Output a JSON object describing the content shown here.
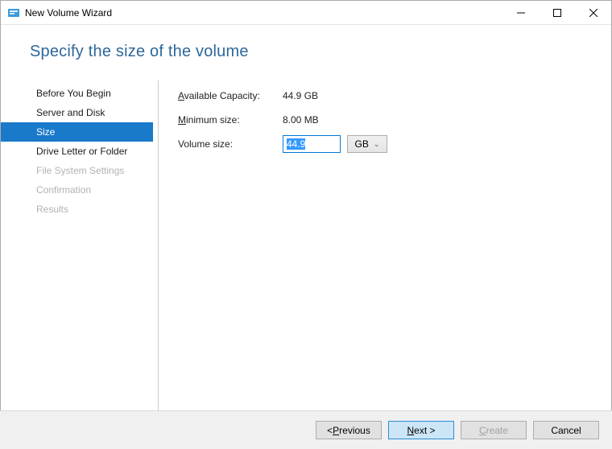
{
  "window": {
    "title": "New Volume Wizard"
  },
  "header": {
    "title": "Specify the size of the volume"
  },
  "sidebar": {
    "s0": "Before You Begin",
    "s1": "Server and Disk",
    "s2": "Size",
    "s3": "Drive Letter or Folder",
    "s4": "File System Settings",
    "s5": "Confirmation",
    "s6": "Results"
  },
  "form": {
    "capacity_label_pre": "A",
    "capacity_label_post": "vailable Capacity:",
    "capacity_value": "44.9 GB",
    "min_label_pre": "M",
    "min_label_post": "inimum size:",
    "min_value": "8.00 MB",
    "volsize_label": "Volume size:",
    "volsize_value": "44.9",
    "volsize_unit": "GB"
  },
  "footer": {
    "prev_pre": "< ",
    "prev_ul": "P",
    "prev_post": "revious",
    "next_ul": "N",
    "next_post": "ext >",
    "create_ul": "C",
    "create_post": "reate",
    "cancel": "Cancel"
  }
}
